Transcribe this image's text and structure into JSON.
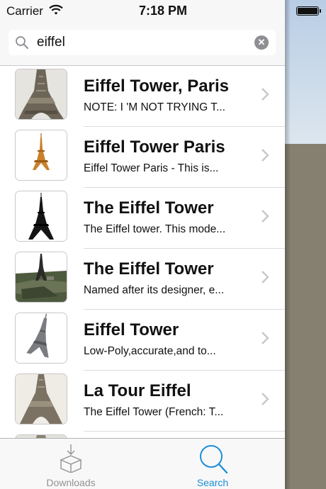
{
  "status_bar": {
    "carrier": "Carrier",
    "time": "7:18 PM"
  },
  "search": {
    "query": "eiffel",
    "placeholder": "Search"
  },
  "results": [
    {
      "title": "Eiffel Tower, Paris",
      "subtitle": "NOTE: I 'M NOT TRYING T...",
      "thumbnail": "eiffel-photo-close"
    },
    {
      "title": "Eiffel Tower Paris",
      "subtitle": "Eiffel Tower Paris - This is...",
      "thumbnail": "eiffel-golden-model"
    },
    {
      "title": "The Eiffel Tower",
      "subtitle": "The Eiffel tower. This mode...",
      "thumbnail": "eiffel-black-model"
    },
    {
      "title": "The Eiffel Tower",
      "subtitle": "Named after its designer, e...",
      "thumbnail": "eiffel-aerial-terrain"
    },
    {
      "title": "Eiffel Tower",
      "subtitle": "Low-Poly,accurate,and to...",
      "thumbnail": "eiffel-lowpoly-model"
    },
    {
      "title": "La Tour Eiffel",
      "subtitle": "The Eiffel Tower (French: T...",
      "thumbnail": "eiffel-photo-sepia"
    }
  ],
  "tabs": [
    {
      "label": "Downloads",
      "icon": "box-download-icon",
      "active": false
    },
    {
      "label": "Search",
      "icon": "magnifier-icon",
      "active": true
    }
  ],
  "colors": {
    "accent": "#1a8fd6",
    "inactive_tab": "#929292",
    "clear_button": "#8e8e93",
    "separator": "#c8c7cc"
  }
}
